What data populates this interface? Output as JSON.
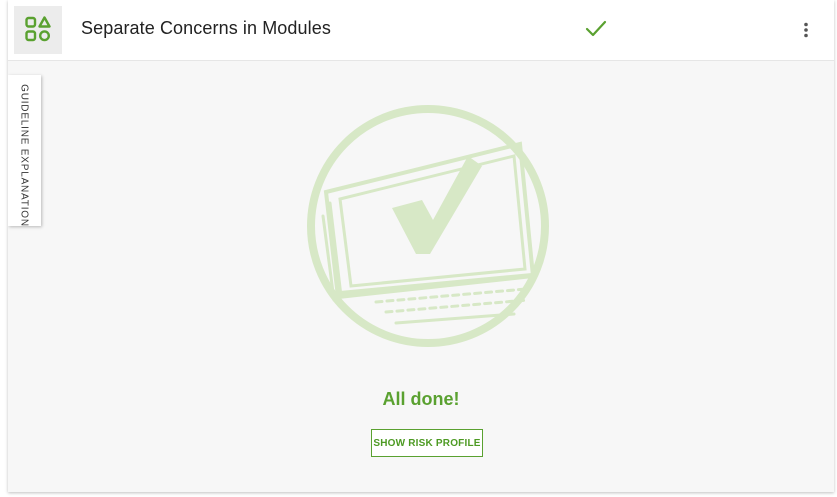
{
  "header": {
    "title": "Separate Concerns in Modules",
    "module_icon": "modules-grid-icon",
    "status_icon": "check-icon",
    "menu_icon": "more-vertical-icon"
  },
  "side_tab": {
    "label": "GUIDELINE EXPLANATION"
  },
  "main": {
    "illustration": "laptop-check-illustration",
    "status_text": "All done!",
    "risk_button_label": "SHOW RISK PROFILE"
  },
  "colors": {
    "accent": "#5aa130",
    "illustration": "#d7e8c6",
    "background": "#f7f7f7"
  }
}
